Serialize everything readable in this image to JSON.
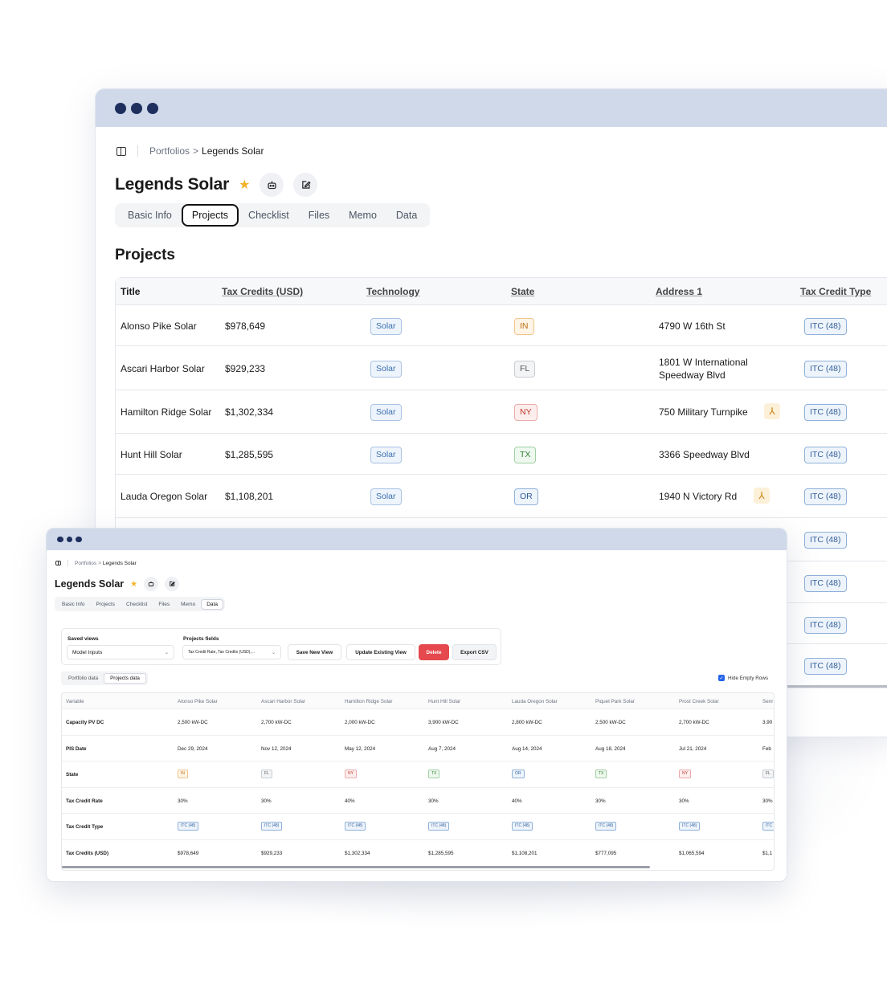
{
  "back": {
    "breadcrumb": {
      "root": "Portfolios",
      "sep": ">",
      "current": "Legends Solar"
    },
    "title": "Legends Solar",
    "tabs": [
      "Basic Info",
      "Projects",
      "Checklist",
      "Files",
      "Memo",
      "Data"
    ],
    "active_tab": "Projects",
    "section_title": "Projects",
    "columns": [
      "Title",
      "Tax Credits (USD)",
      "Technology",
      "State",
      "Address 1",
      "Tax Credit Type"
    ],
    "rows": [
      {
        "title": "Alonso Pike Solar",
        "credits": "$978,649",
        "tech": "Solar",
        "state": "IN",
        "address": "4790 W 16th St",
        "type": "ITC (48)"
      },
      {
        "title": "Ascari Harbor Solar",
        "credits": "$929,233",
        "tech": "Solar",
        "state": "FL",
        "address": "1801 W International Speedway Blvd",
        "type": "ITC (48)"
      },
      {
        "title": "Hamilton Ridge Solar",
        "credits": "$1,302,334",
        "tech": "Solar",
        "state": "NY",
        "address": "750 Military Turnpike",
        "type": "ITC (48)"
      },
      {
        "title": "Hunt Hill Solar",
        "credits": "$1,285,595",
        "tech": "Solar",
        "state": "TX",
        "address": "3366 Speedway Blvd",
        "type": "ITC (48)"
      },
      {
        "title": "Lauda Oregon Solar",
        "credits": "$1,108,201",
        "tech": "Solar",
        "state": "OR",
        "address": "1940 N Victory Rd",
        "type": "ITC (48)"
      }
    ],
    "extra_types": [
      "ITC (48)",
      "ITC (48)",
      "ITC (48)",
      "ITC (48)"
    ]
  },
  "front": {
    "breadcrumb": {
      "root": "Portfolios",
      "sep": ">",
      "current": "Legends Solar"
    },
    "title": "Legends Solar",
    "tabs": [
      "Basic Info",
      "Projects",
      "Checklist",
      "Files",
      "Memo",
      "Data"
    ],
    "active_tab": "Data",
    "saved_views_label": "Saved views",
    "saved_views_value": "Model Inputs",
    "fields_label": "Projects fields",
    "fields_value": "Tax Credit Rate, Tax Credits (USD),...",
    "buttons": {
      "save_new": "Save New View",
      "update": "Update Existing View",
      "delete": "Delete",
      "export": "Export CSV"
    },
    "subtabs": [
      "Portfolio data",
      "Projects data"
    ],
    "active_subtab": "Projects data",
    "hide_empty_label": "Hide Empty Rows",
    "columns": [
      "Variable",
      "Alonso Pike Solar",
      "Ascari Harbor Solar",
      "Hamilton Ridge Solar",
      "Hunt Hill Solar",
      "Lauda Oregon Solar",
      "Piquet Park Solar",
      "Prost Creek Solar",
      "Senr"
    ],
    "rows": [
      {
        "var": "Capacity PV DC",
        "vals": [
          "2,500 kW-DC",
          "2,700 kW-DC",
          "2,000 kW-DC",
          "3,900 kW-DC",
          "2,800 kW-DC",
          "2,500 kW-DC",
          "2,700 kW-DC",
          "3,90"
        ]
      },
      {
        "var": "PIS Date",
        "vals": [
          "Dec 29, 2024",
          "Nov 12, 2024",
          "May 12, 2024",
          "Aug 7, 2024",
          "Aug 14, 2024",
          "Aug 18, 2024",
          "Jul 21, 2024",
          "Feb"
        ]
      },
      {
        "var": "State",
        "vals": [
          "IN",
          "FL",
          "NY",
          "TX",
          "OR",
          "TX",
          "NY",
          "FL"
        ],
        "badge": true
      },
      {
        "var": "Tax Credit Rate",
        "vals": [
          "30%",
          "30%",
          "40%",
          "30%",
          "40%",
          "30%",
          "30%",
          "30%"
        ]
      },
      {
        "var": "Tax Credit Type",
        "vals": [
          "ITC (48)",
          "ITC (48)",
          "ITC (48)",
          "ITC (48)",
          "ITC (48)",
          "ITC (48)",
          "ITC (48)",
          "ITC"
        ],
        "badge": true
      },
      {
        "var": "Tax Credits (USD)",
        "vals": [
          "$978,649",
          "$929,233",
          "$1,302,334",
          "$1,285,595",
          "$1,108,201",
          "$777,095",
          "$1,065,594",
          "$1,1"
        ]
      }
    ]
  },
  "colors": {
    "titlebar": "#cfd9ea",
    "dots": "#1e2f5e",
    "star": "#f0b429",
    "danger": "#e5484d",
    "checkbox": "#2563eb"
  },
  "icons": {
    "sidebar": "panel-left-icon",
    "star": "star-icon",
    "robot": "robot-icon",
    "edit": "edit-icon",
    "warning": "merge-warning-icon",
    "chevron": "chevron-down-icon",
    "check": "check-icon"
  }
}
